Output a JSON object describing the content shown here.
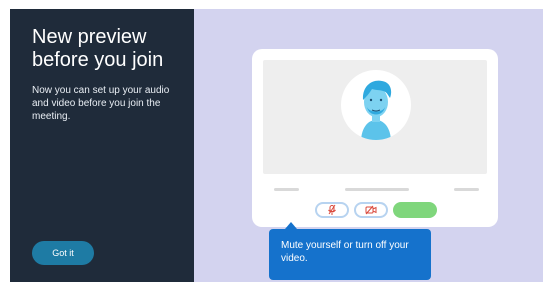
{
  "intro": {
    "title": "New preview before you join",
    "description": "Now you can set up your audio and video before you join the meeting.",
    "got_it_label": "Got it"
  },
  "preview": {
    "controls": [
      {
        "name": "mic-toggle",
        "icon": "mic-off-icon"
      },
      {
        "name": "camera-toggle",
        "icon": "camera-off-icon"
      },
      {
        "name": "join-button"
      }
    ]
  },
  "tooltip": {
    "text": "Mute yourself or turn off your video."
  },
  "colors": {
    "panel_bg": "#1f2b3a",
    "accent": "#1e7ba4",
    "canvas_bg": "#d3d3ef",
    "tooltip_bg": "#1572cc",
    "join_green": "#7fd67c",
    "icon_red": "#d9483b"
  }
}
